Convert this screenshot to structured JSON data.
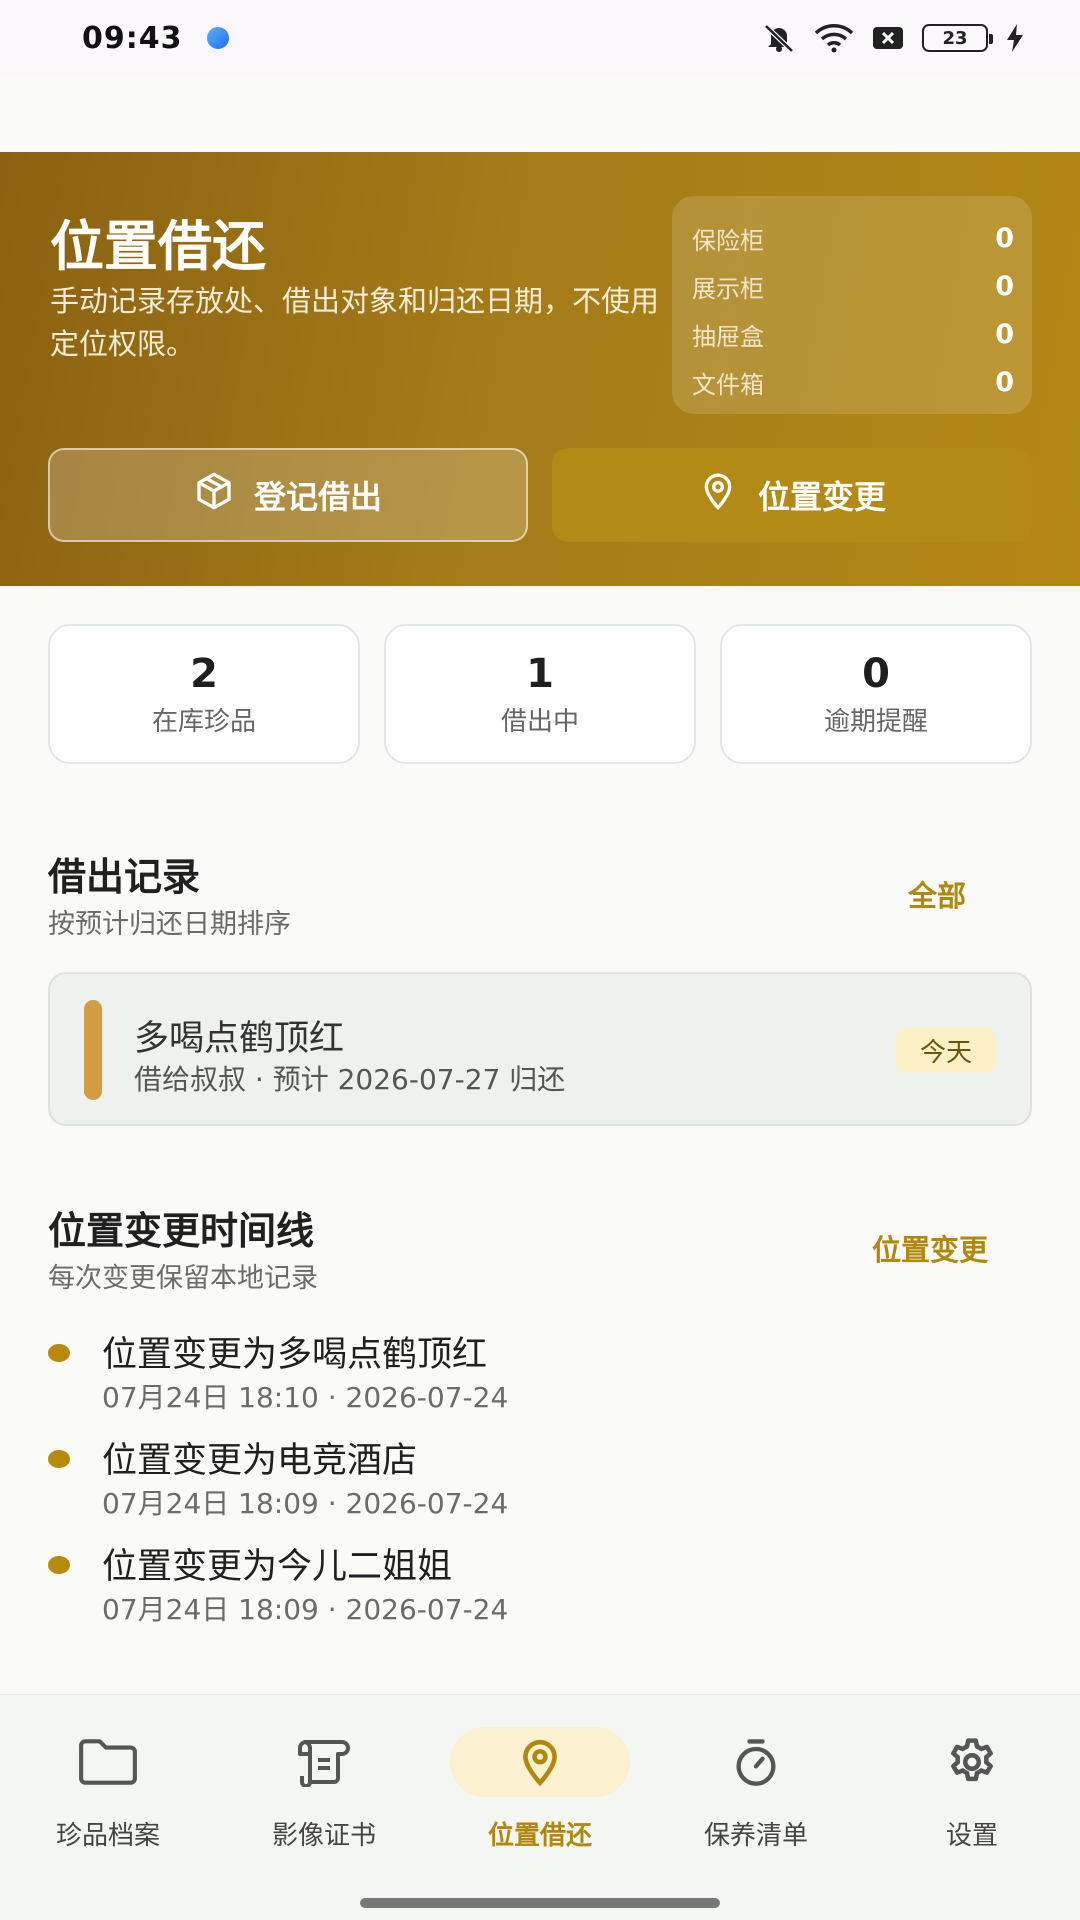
{
  "status_bar": {
    "time": "09:43",
    "battery": "23"
  },
  "hero": {
    "title": "位置借还",
    "description": "手动记录存放处、借出对象和归还日期，不使用定位权限。",
    "storage": [
      {
        "label": "保险柜",
        "count": "0"
      },
      {
        "label": "展示柜",
        "count": "0"
      },
      {
        "label": "抽屉盒",
        "count": "0"
      },
      {
        "label": "文件箱",
        "count": "0"
      }
    ],
    "loan_button": "登记借出",
    "move_button": "位置变更",
    "colors": {
      "gradient_start": "#8a6211",
      "gradient_end": "#b38815"
    }
  },
  "stats": [
    {
      "value": "2",
      "label": "在库珍品"
    },
    {
      "value": "1",
      "label": "借出中"
    },
    {
      "value": "0",
      "label": "逾期提醒"
    }
  ],
  "loans": {
    "title": "借出记录",
    "subtitle": "按预计归还日期排序",
    "link": "全部",
    "items": [
      {
        "name": "多喝点鹤顶红",
        "detail": "借给叔叔 · 预计 2026-07-27 归还",
        "badge": "今天"
      }
    ]
  },
  "timeline": {
    "title": "位置变更时间线",
    "subtitle": "每次变更保留本地记录",
    "link": "位置变更",
    "items": [
      {
        "title": "位置变更为多喝点鹤顶红",
        "time": "07月24日 18:10 · 2026-07-24"
      },
      {
        "title": "位置变更为电竞酒店",
        "time": "07月24日 18:09 · 2026-07-24"
      },
      {
        "title": "位置变更为今儿二姐姐",
        "time": "07月24日 18:09 · 2026-07-24"
      }
    ]
  },
  "nav": {
    "active": "位置借还",
    "accent": "#b1880f",
    "items": [
      {
        "label": "珍品档案",
        "icon": "folder-icon"
      },
      {
        "label": "影像证书",
        "icon": "scroll-icon"
      },
      {
        "label": "位置借还",
        "icon": "location-pin-icon"
      },
      {
        "label": "保养清单",
        "icon": "timer-icon"
      },
      {
        "label": "设置",
        "icon": "gear-icon"
      }
    ]
  }
}
